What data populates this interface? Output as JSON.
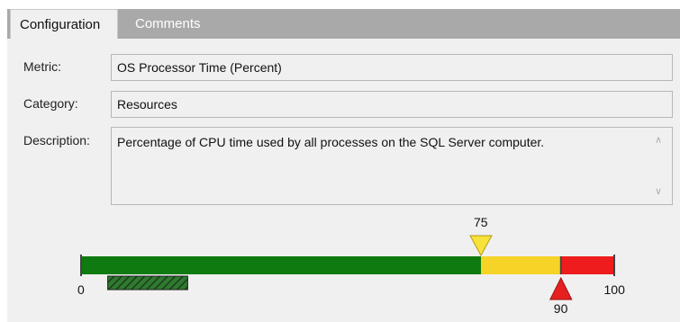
{
  "tabs": {
    "configuration": "Configuration",
    "comments": "Comments"
  },
  "form": {
    "metric_label": "Metric:",
    "metric_value": "OS Processor Time (Percent)",
    "category_label": "Category:",
    "category_value": "Resources",
    "description_label": "Description:",
    "description_value": "Percentage of CPU time used by all processes on the SQL Server computer."
  },
  "threshold": {
    "min": 0,
    "max": 100,
    "min_label": "0",
    "max_label": "100",
    "warning": 75,
    "warning_label": "75",
    "critical": 90,
    "critical_label": "90",
    "baseline_start": 5,
    "baseline_end": 20,
    "colors": {
      "ok": "#0f7a0f",
      "warning": "#f5d327",
      "critical": "#ee1c1c",
      "warning_marker": "#f7e13b",
      "critical_marker": "#e62020",
      "baseline": "#3f6b3f"
    }
  },
  "icons": {
    "scroll_up": "chevron-up-icon",
    "scroll_down": "chevron-down-icon",
    "warning_marker": "triangle-down-icon",
    "critical_marker": "triangle-up-icon"
  }
}
